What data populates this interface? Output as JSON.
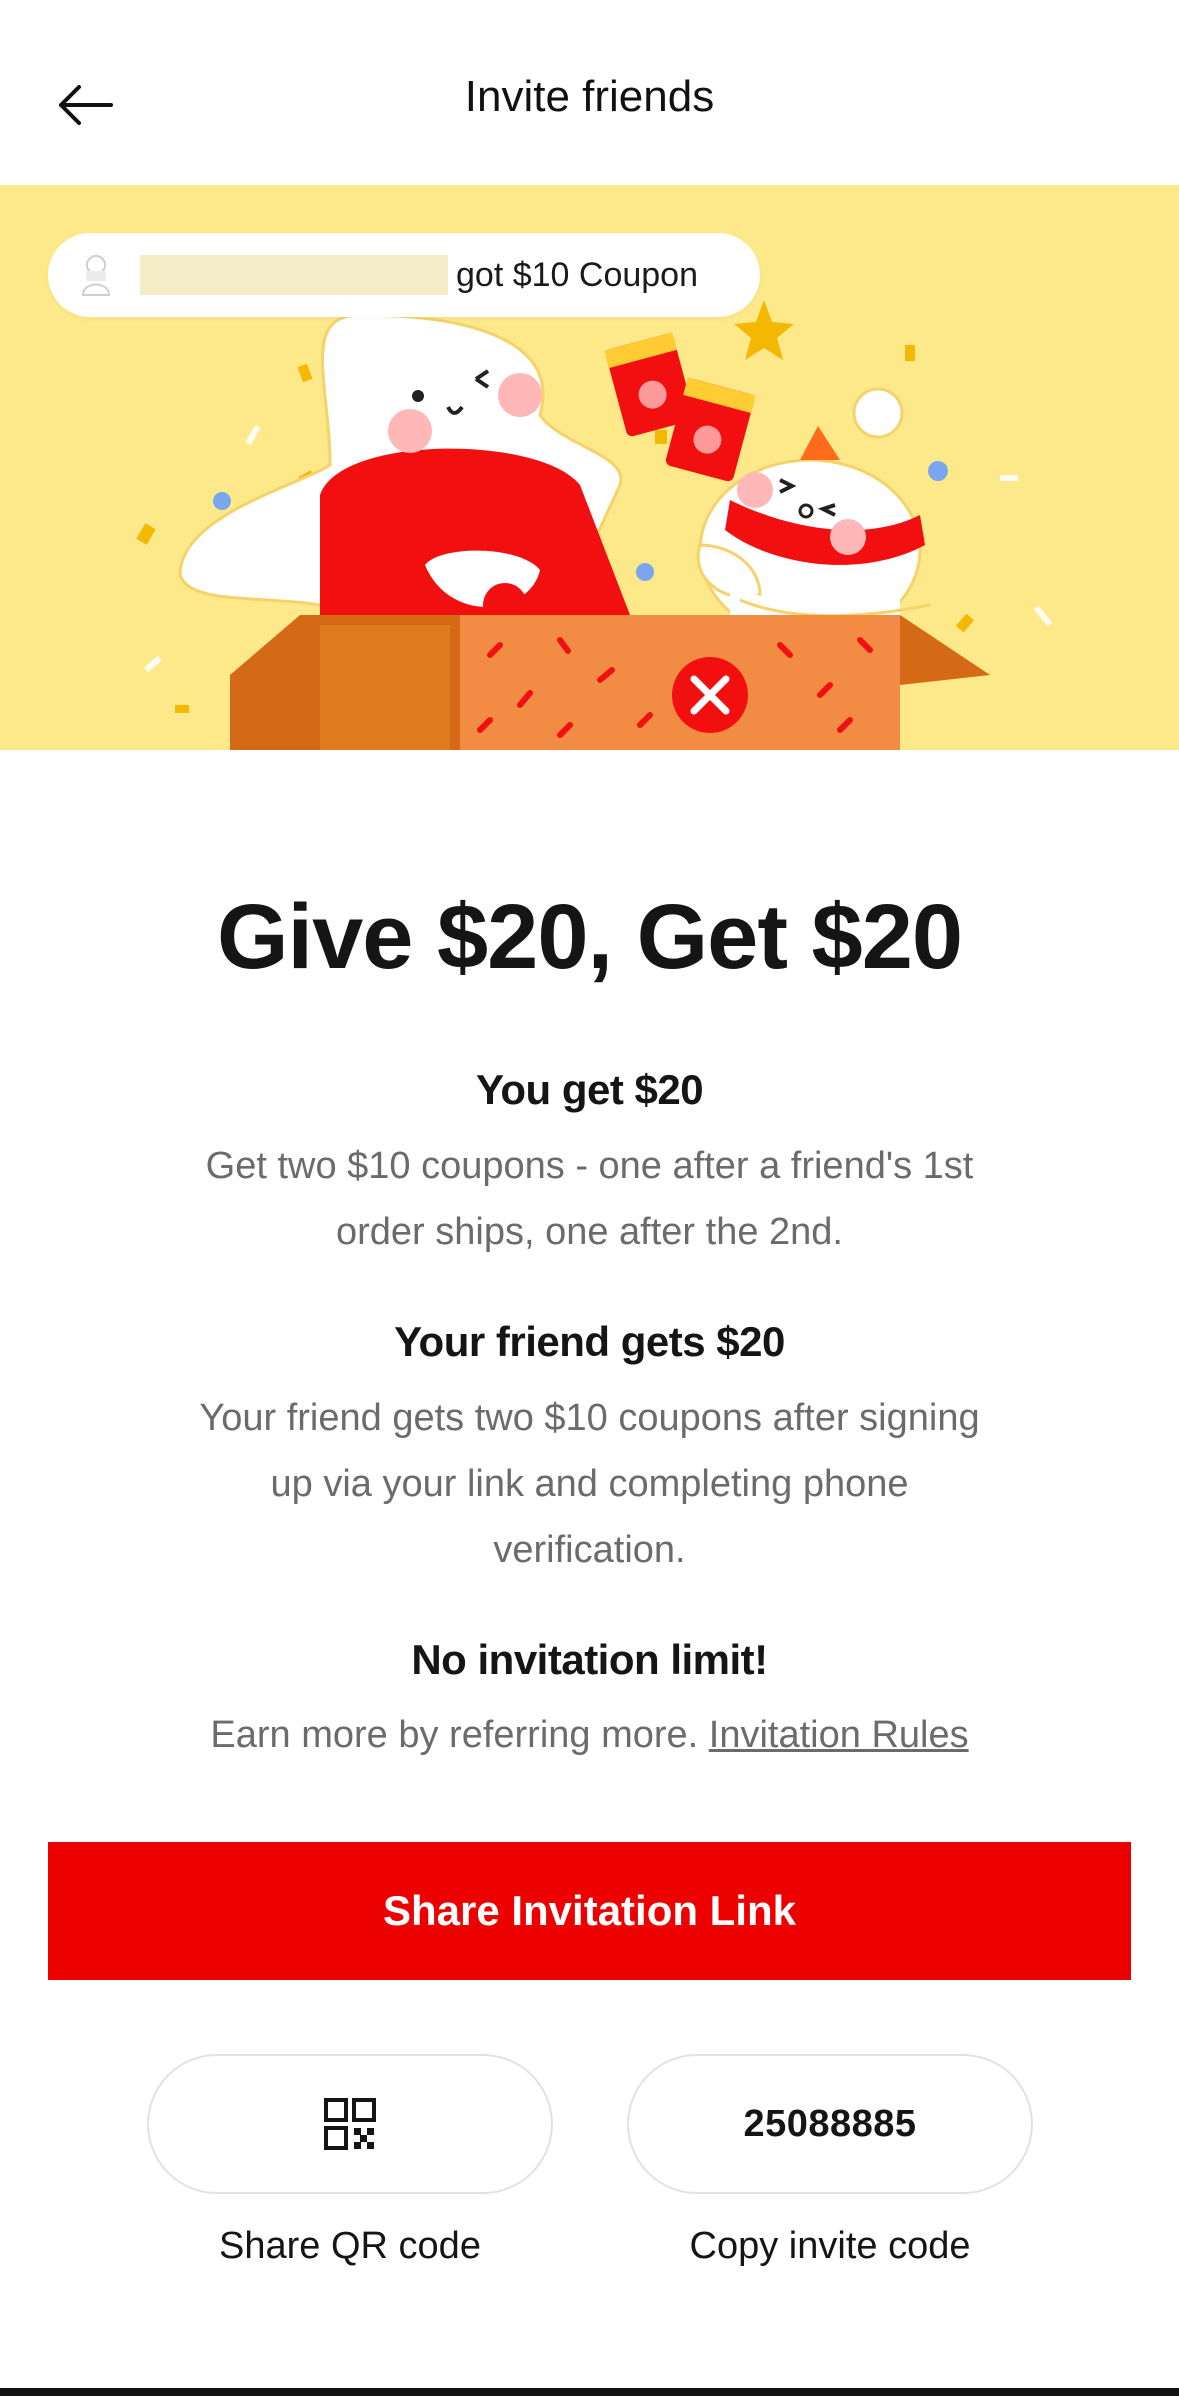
{
  "header": {
    "back_icon": "arrow-left-icon",
    "title": "Invite friends"
  },
  "banner": {
    "ticker_text": "got $10 Coupon",
    "avatar_icon": "user-avatar-icon",
    "background_color": "#fde98a"
  },
  "main": {
    "headline": "Give $20, Get $20",
    "you_get": {
      "title": "You get $20",
      "line1": "Get two $10 coupons - one after a friend's 1st",
      "line2": "order ships, one after the 2nd."
    },
    "friend_gets": {
      "title": "Your friend gets $20",
      "line1": "Your friend gets two $10 coupons after signing",
      "line2": "up via your link and completing phone",
      "line3": "verification."
    },
    "no_limit": {
      "title": "No invitation limit!",
      "text": "Earn more by referring more.",
      "rules_link": "Invitation Rules"
    }
  },
  "actions": {
    "share_link_label": "Share Invitation Link",
    "qr_icon": "qr-code-icon",
    "qr_caption": "Share QR code",
    "invite_code": "25088885",
    "copy_caption": "Copy invite code"
  },
  "colors": {
    "accent": "#ec0000",
    "banner": "#fde98a",
    "text_muted": "#6b6b6b"
  }
}
